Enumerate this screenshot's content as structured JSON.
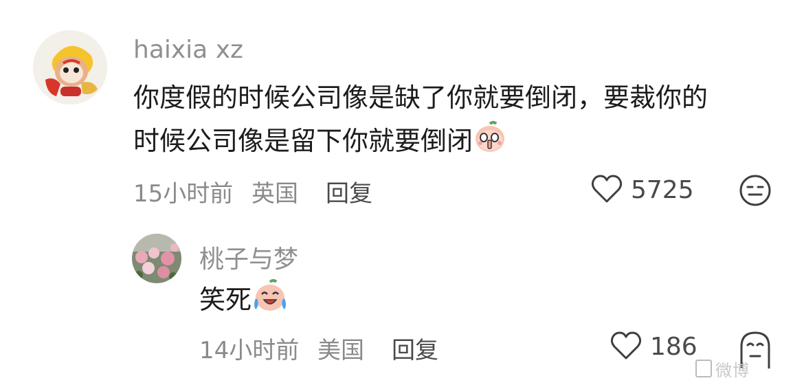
{
  "comments": [
    {
      "username": "haixia xz",
      "text_line1": "你度假的时候公司像是缺了你就要倒闭，要裁你的",
      "text_line2": "时候公司像是留下你就要倒闭",
      "emoji_icon": "peach-shush-emoji",
      "time": "15小时前",
      "location": "英国",
      "reply_label": "回复",
      "likes": "5725",
      "reaction_icon": "meh-face-icon"
    },
    {
      "username": "桃子与梦",
      "text": "笑死",
      "emoji_icon": "peach-laugh-cry-emoji",
      "time": "14小时前",
      "location": "美国",
      "reply_label": "回复",
      "likes": "186",
      "reaction_icon": "ghost-face-icon"
    }
  ],
  "watermark": "微博"
}
